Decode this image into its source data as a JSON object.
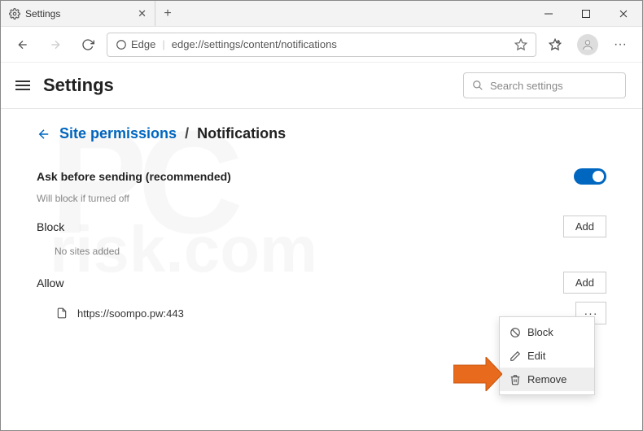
{
  "tab": {
    "title": "Settings"
  },
  "toolbar": {
    "brand": "Edge",
    "url": "edge://settings/content/notifications"
  },
  "header": {
    "title": "Settings",
    "search_placeholder": "Search settings"
  },
  "breadcrumb": {
    "parent": "Site permissions",
    "separator": "/",
    "current": "Notifications"
  },
  "ask": {
    "label": "Ask before sending (recommended)",
    "sub": "Will block if turned off",
    "enabled": true
  },
  "block": {
    "label": "Block",
    "add": "Add",
    "empty": "No sites added"
  },
  "allow": {
    "label": "Allow",
    "add": "Add",
    "items": [
      {
        "url": "https://soompo.pw:443"
      }
    ]
  },
  "menu": {
    "block": "Block",
    "edit": "Edit",
    "remove": "Remove"
  }
}
